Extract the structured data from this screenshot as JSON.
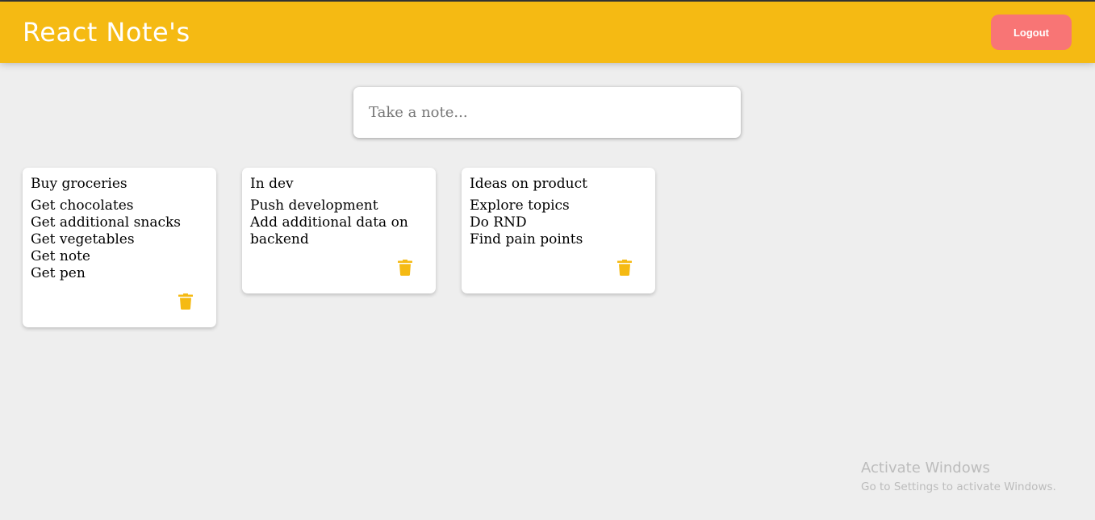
{
  "header": {
    "title": "React Note's",
    "logout_label": "Logout",
    "accent_color": "#f5ba13",
    "logout_color": "#f87575"
  },
  "create_note": {
    "placeholder": "Take a note..."
  },
  "notes": [
    {
      "title": "Buy groceries",
      "content": "Get chocolates\nGet additional snacks\nGet vegetables\nGet note\nGet pen"
    },
    {
      "title": "In dev",
      "content": "Push development\nAdd additional data on backend"
    },
    {
      "title": "Ideas on product",
      "content": "Explore topics\nDo RND\nFind pain points"
    }
  ],
  "icons": {
    "delete": "trash-icon"
  },
  "watermark": {
    "title": "Activate Windows",
    "subtitle": "Go to Settings to activate Windows."
  }
}
